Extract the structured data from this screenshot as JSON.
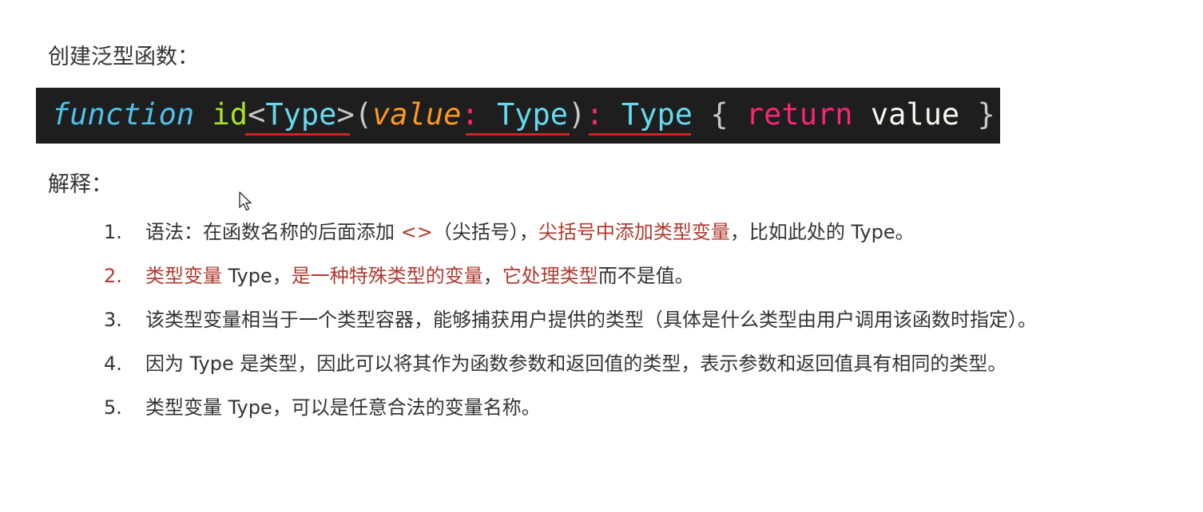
{
  "heading_create": "创建泛型函数：",
  "heading_explain": "解释：",
  "code": {
    "kw_function": "function",
    "fn_name": "id",
    "lt": "<",
    "type1": "Type",
    "gt": ">",
    "paren_open": "(",
    "param": "value",
    "colon1": ":",
    "type2": "Type",
    "paren_close": ")",
    "colon2": ":",
    "type3": "Type",
    "brace_open": "{",
    "kw_return": "return",
    "ret_value": "value",
    "brace_close": "}",
    "underline_color": "#d0241b"
  },
  "list": [
    {
      "num": "1.",
      "parts": {
        "a": "语法：在函数名称的后面添加 ",
        "b": "<>",
        "c": "（尖括号），",
        "d": "尖括号中添加类型变量",
        "e": "，比如此处的 Type。"
      }
    },
    {
      "num": "2.",
      "parts": {
        "a": "类型变量",
        "b": " Type，",
        "c": "是一种特殊类型的变量",
        "d": "，",
        "e": "它处理类型",
        "f": "而不是值。"
      }
    },
    {
      "num": "3.",
      "text": "该类型变量相当于一个类型容器，能够捕获用户提供的类型（具体是什么类型由用户调用该函数时指定）。"
    },
    {
      "num": "4.",
      "text": "因为 Type 是类型，因此可以将其作为函数参数和返回值的类型，表示参数和返回值具有相同的类型。"
    },
    {
      "num": "5.",
      "text": "类型变量 Type，可以是任意合法的变量名称。"
    }
  ],
  "colors": {
    "highlight_red": "#b03a2e",
    "code_bg": "#1e1e1e"
  }
}
